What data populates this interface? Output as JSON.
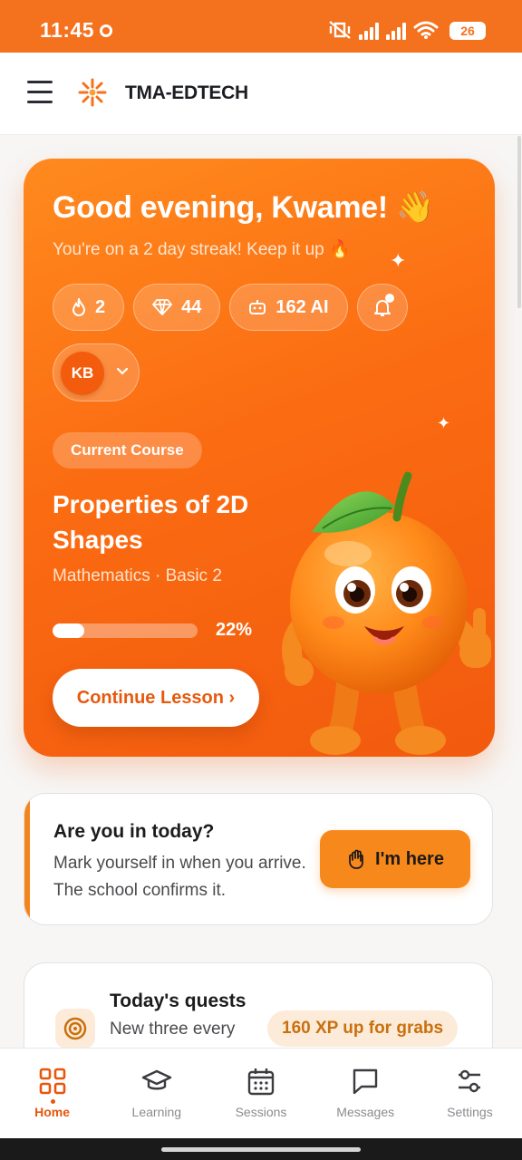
{
  "status_bar": {
    "time": "11:45",
    "battery": "26"
  },
  "header": {
    "brand": "TMA-EDTECH"
  },
  "hero": {
    "greeting": "Good evening, Kwame! 👋",
    "streak": "You're on a 2 day streak! Keep it up 🔥",
    "stats": {
      "streak_count": "2",
      "gems": "44",
      "ai_credits": "162 AI"
    },
    "profile_initials": "KB",
    "course_tag": "Current Course",
    "course_title": "Properties of 2D Shapes",
    "course_subtitle": "Mathematics · Basic 2",
    "progress_label": "22%",
    "progress_value": 0.22,
    "continue_label": "Continue Lesson ›"
  },
  "attendance": {
    "title": "Are you in today?",
    "text": "Mark yourself in when you arrive. The school confirms it.",
    "button_label": "I'm here"
  },
  "quests": {
    "title": "Today's quests",
    "subtitle": "New three every",
    "xp_badge": "160 XP up for grabs"
  },
  "nav": {
    "items": [
      {
        "label": "Home",
        "icon": "grid-icon",
        "active": true
      },
      {
        "label": "Learning",
        "icon": "graduation-cap-icon",
        "active": false
      },
      {
        "label": "Sessions",
        "icon": "calendar-icon",
        "active": false
      },
      {
        "label": "Messages",
        "icon": "chat-bubble-icon",
        "active": false
      },
      {
        "label": "Settings",
        "icon": "sliders-icon",
        "active": false
      }
    ]
  },
  "colors": {
    "accent": "#f4711d",
    "accent_dark": "#e8560c",
    "button_orange": "#f7891c"
  }
}
